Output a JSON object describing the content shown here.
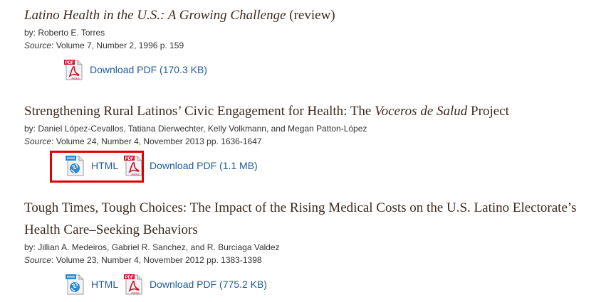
{
  "articles": [
    {
      "title_italic": "Latino Health in the U.S.: A Growing Challenge",
      "title_tail": " (review)",
      "by_prefix": "by: ",
      "authors": "Roberto E. Torres",
      "source_label": "Source",
      "source_value": ": Volume 7, Number 2, 1996 p. 159",
      "pdf_label": "Download PDF (170.3 KB)"
    },
    {
      "title_pre": "Strengthening Rural Latinos’ Civic Engagement for Health: The ",
      "title_italic": "Voceros de Salud",
      "title_tail": " Project",
      "by_prefix": "by: ",
      "authors": "Daniel López-Cevallos, Tatiana Dierwechter, Kelly Volkmann, and Megan Patton-López",
      "source_label": "Source",
      "source_value": ": Volume 24, Number 4, November 2013 pp. 1636-1647",
      "html_label": "HTML",
      "pdf_label": "Download PDF (1.1 MB)"
    },
    {
      "title_line1": "Tough Times, Tough Choices: The Impact of the Rising Medical Costs on the U.S. Latino Electorate’s",
      "title_line2": "Health Care–Seeking Behaviors",
      "by_prefix": "by: ",
      "authors": "Jillian A. Medeiros, Gabriel R. Sanchez, and R. Burciaga Valdez",
      "source_label": "Source",
      "source_value": ": Volume 23, Number 4, November 2012 pp. 1383-1398",
      "html_label": "HTML",
      "pdf_label": "Download PDF (775.2 KB)"
    }
  ],
  "icons": {
    "pdf": "pdf-icon",
    "html": "html-globe-icon"
  },
  "colors": {
    "title": "#3b2a1f",
    "link": "#1f5a9c",
    "highlight": "#e00000",
    "pdf_red": "#c8102e",
    "globe_blue": "#2a8ad4"
  },
  "icon_text": {
    "pdf_tag": "PDF",
    "pdf_brand": "Adobe"
  }
}
